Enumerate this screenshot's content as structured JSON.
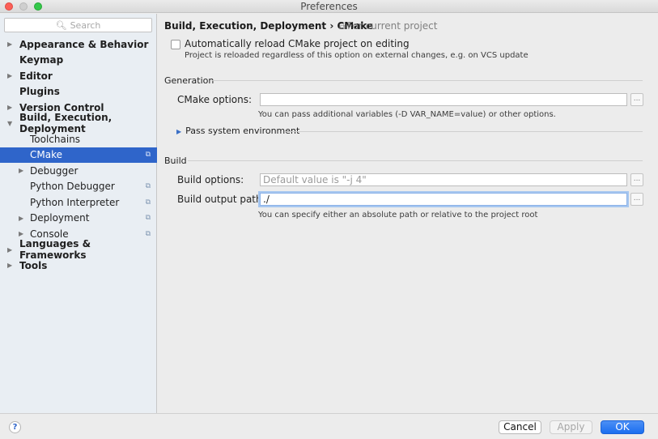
{
  "window": {
    "title": "Preferences"
  },
  "search": {
    "placeholder": "Search"
  },
  "sidebar": {
    "items": [
      {
        "label": "Appearance & Behavior",
        "level": 0,
        "arrow": "▶",
        "project": ""
      },
      {
        "label": "Keymap",
        "level": 0,
        "arrow": "",
        "project": ""
      },
      {
        "label": "Editor",
        "level": 0,
        "arrow": "▶",
        "project": ""
      },
      {
        "label": "Plugins",
        "level": 0,
        "arrow": "",
        "project": ""
      },
      {
        "label": "Version Control",
        "level": 0,
        "arrow": "▶",
        "project": ""
      },
      {
        "label": "Build, Execution, Deployment",
        "level": 0,
        "arrow": "▼",
        "project": ""
      },
      {
        "label": "Toolchains",
        "level": 1,
        "arrow": "",
        "project": ""
      },
      {
        "label": "CMake",
        "level": 1,
        "arrow": "",
        "project": "⧉",
        "selected": true
      },
      {
        "label": "Debugger",
        "level": 1,
        "arrow": "▶",
        "project": ""
      },
      {
        "label": "Python Debugger",
        "level": 1,
        "arrow": "",
        "project": "⧉"
      },
      {
        "label": "Python Interpreter",
        "level": 1,
        "arrow": "",
        "project": "⧉"
      },
      {
        "label": "Deployment",
        "level": 1,
        "arrow": "▶",
        "project": "⧉"
      },
      {
        "label": "Console",
        "level": 1,
        "arrow": "▶",
        "project": "⧉"
      },
      {
        "label": "Languages & Frameworks",
        "level": 0,
        "arrow": "▶",
        "project": ""
      },
      {
        "label": "Tools",
        "level": 0,
        "arrow": "▶",
        "project": ""
      }
    ]
  },
  "content": {
    "breadcrumb": "Build, Execution, Deployment › CMake",
    "for_project": "For current project",
    "auto_reload": {
      "label": "Automatically reload CMake project on editing",
      "checked": false,
      "hint": "Project is reloaded regardless of this option on external changes, e.g. on VCS update"
    },
    "generation": {
      "title": "Generation",
      "cmake_options_label": "CMake options:",
      "cmake_options_value": "",
      "cmake_options_hint": "You can pass additional variables (-D VAR_NAME=value) or other options.",
      "pass_env_label": "Pass system environment"
    },
    "build": {
      "title": "Build",
      "build_options_label": "Build options:",
      "build_options_placeholder": "Default value is \"-j 4\"",
      "output_path_label": "Build output path:",
      "output_path_value": "./",
      "output_path_hint": "You can specify either an absolute path or relative to the project root"
    },
    "browse_label": "..."
  },
  "footer": {
    "help_label": "?",
    "cancel_label": "Cancel",
    "apply_label": "Apply",
    "ok_label": "OK"
  },
  "colors": {
    "selection": "#2f65ca",
    "ok_button": "#1a6ef0",
    "focus_ring": "#a7c7f0"
  }
}
